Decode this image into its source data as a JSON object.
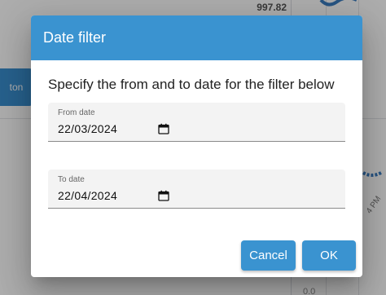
{
  "background": {
    "value_label": "997.82",
    "side_button_label": "ton",
    "bottom_label": "0.0",
    "time_label": "4 PM"
  },
  "dialog": {
    "title": "Date filter",
    "instruction": "Specify the from and to date for the filter below",
    "from_field": {
      "label": "From date",
      "value": "22/03/2024"
    },
    "to_field": {
      "label": "To date",
      "value": "22/04/2024"
    },
    "cancel_label": "Cancel",
    "ok_label": "OK"
  },
  "colors": {
    "header": "#3a93d0",
    "button": "#3a93d0"
  },
  "icons": {
    "date_picker": "calendar-icon"
  }
}
